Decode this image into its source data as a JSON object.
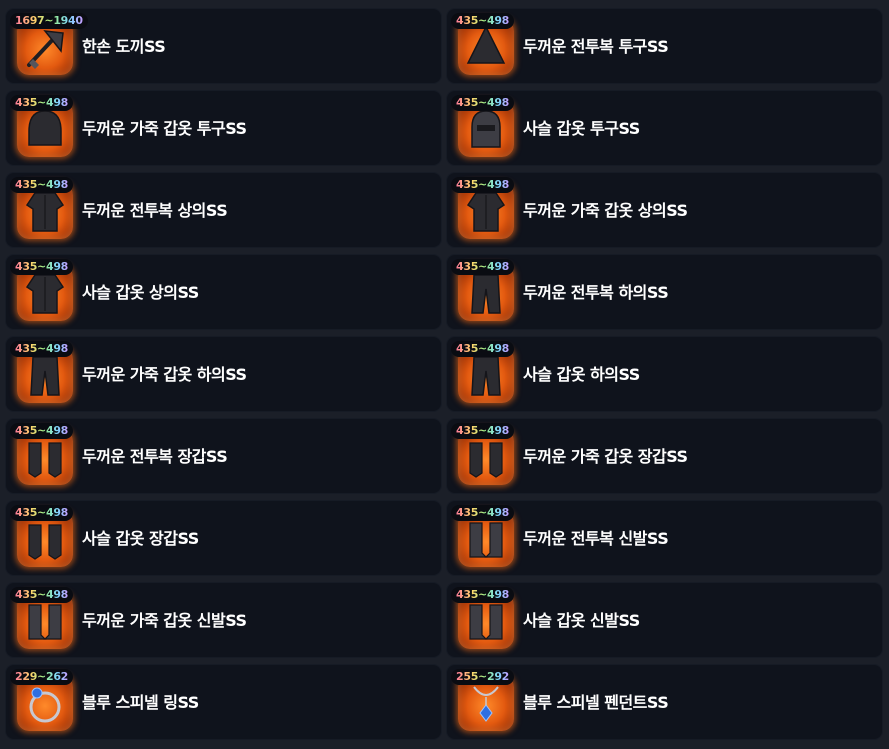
{
  "items": [
    {
      "level": "1697~1940",
      "name": "한손 도끼SS",
      "icon": "one-hand-axe-icon"
    },
    {
      "level": "435~498",
      "name": "두꺼운 전투복 투구SS",
      "icon": "cloth-helmet-icon"
    },
    {
      "level": "435~498",
      "name": "두꺼운 가죽 갑옷 투구SS",
      "icon": "leather-helmet-icon"
    },
    {
      "level": "435~498",
      "name": "사슬 갑옷 투구SS",
      "icon": "chain-helmet-icon"
    },
    {
      "level": "435~498",
      "name": "두꺼운 전투복 상의SS",
      "icon": "cloth-top-icon"
    },
    {
      "level": "435~498",
      "name": "두꺼운 가죽 갑옷 상의SS",
      "icon": "leather-top-icon"
    },
    {
      "level": "435~498",
      "name": "사슬 갑옷 상의SS",
      "icon": "chain-top-icon"
    },
    {
      "level": "435~498",
      "name": "두꺼운 전투복 하의SS",
      "icon": "cloth-bottom-icon"
    },
    {
      "level": "435~498",
      "name": "두꺼운 가죽 갑옷 하의SS",
      "icon": "leather-bottom-icon"
    },
    {
      "level": "435~498",
      "name": "사슬 갑옷 하의SS",
      "icon": "chain-bottom-icon"
    },
    {
      "level": "435~498",
      "name": "두꺼운 전투복 장갑SS",
      "icon": "cloth-gloves-icon"
    },
    {
      "level": "435~498",
      "name": "두꺼운 가죽 갑옷 장갑SS",
      "icon": "leather-gloves-icon"
    },
    {
      "level": "435~498",
      "name": "사슬 갑옷 장갑SS",
      "icon": "chain-gloves-icon"
    },
    {
      "level": "435~498",
      "name": "두꺼운 전투복 신발SS",
      "icon": "cloth-boots-icon"
    },
    {
      "level": "435~498",
      "name": "두꺼운 가죽 갑옷 신발SS",
      "icon": "leather-boots-icon"
    },
    {
      "level": "435~498",
      "name": "사슬 갑옷 신발SS",
      "icon": "chain-boots-icon"
    },
    {
      "level": "229~262",
      "name": "블루 스피넬 링SS",
      "icon": "blue-spinel-ring-icon"
    },
    {
      "level": "255~292",
      "name": "블루 스피넬 펜던트SS",
      "icon": "blue-spinel-pendant-icon"
    }
  ]
}
